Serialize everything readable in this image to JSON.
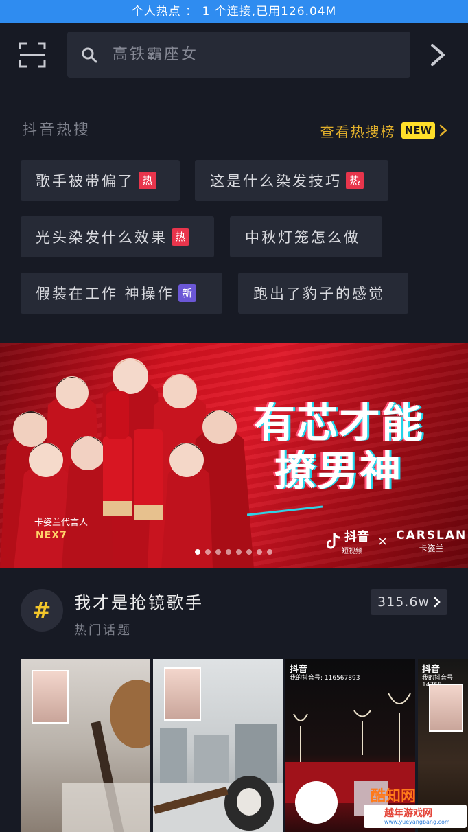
{
  "status_bar": {
    "text": "个人热点 ： 1 个连接,已用126.04M"
  },
  "search": {
    "query": "高铁霸座女"
  },
  "hot_search": {
    "title": "抖音热搜",
    "link_label": "查看热搜榜",
    "new_badge": "NEW",
    "chips": [
      {
        "label": "歌手被带偏了",
        "badge": "热",
        "badge_color": "#e8354c"
      },
      {
        "label": "这是什么染发技巧",
        "badge": "热",
        "badge_color": "#e8354c"
      },
      {
        "label": "光头染发什么效果",
        "badge": "热",
        "badge_color": "#e8354c"
      },
      {
        "label": "中秋灯笼怎么做",
        "badge": "",
        "badge_color": ""
      },
      {
        "label": "假装在工作 神操作",
        "badge": "新",
        "badge_color": "#6b57d6"
      },
      {
        "label": "跑出了豹子的感觉",
        "badge": "",
        "badge_color": ""
      }
    ]
  },
  "banner": {
    "headline_line1": "有芯才能",
    "headline_line2": "撩男神",
    "ambassador": "卡姿兰代言人",
    "group": "NEX7",
    "brand_douyin": "抖音",
    "brand_douyin_sub": "短视频",
    "brand_x": "×",
    "brand_carslan": "CARSLAN",
    "brand_carslan_sub": "卡姿兰",
    "dots_total": 8,
    "dot_active": 0
  },
  "topic": {
    "icon_symbol": "#",
    "title": "我才是抢镜歌手",
    "subtitle": "热门话题",
    "count": "315.6w"
  },
  "videos": [
    {
      "label": ""
    },
    {
      "label": ""
    },
    {
      "label": "抖音",
      "id": "我的抖音号: 116567893"
    },
    {
      "label": "抖音",
      "id": "我的抖音号: 14768"
    }
  ],
  "watermark": {
    "name": "酷知网",
    "cn": "越年游戏网",
    "url": "www.yueyangbang.com"
  }
}
